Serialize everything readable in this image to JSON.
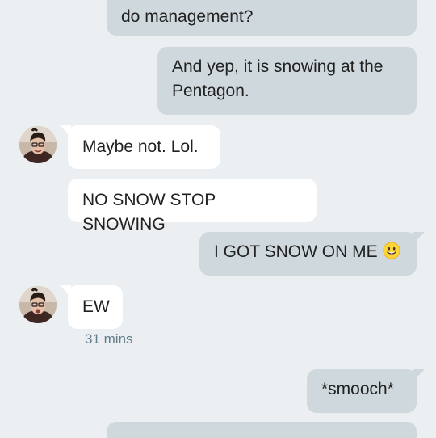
{
  "messages": [
    {
      "id": "m1",
      "direction": "sent",
      "text": "do management?"
    },
    {
      "id": "m2",
      "direction": "sent",
      "text": "And yep, it is snowing at the Pentagon."
    },
    {
      "id": "m3",
      "direction": "received",
      "text": "Maybe not. Lol."
    },
    {
      "id": "m4",
      "direction": "received",
      "text": "NO SNOW STOP SNOWING"
    },
    {
      "id": "m5",
      "direction": "sent",
      "text": "I GOT SNOW ON ME",
      "emoji": "smiling-face-with-tongue-icon"
    },
    {
      "id": "m6",
      "direction": "received",
      "text": "EW",
      "timestamp": "31 mins"
    },
    {
      "id": "m7",
      "direction": "sent",
      "text": "*smooch*"
    }
  ],
  "colors": {
    "background": "#eceff1",
    "sent_bubble": "#cfd8dc",
    "received_bubble": "#ffffff",
    "text": "#212121",
    "timestamp": "#607d8b"
  }
}
